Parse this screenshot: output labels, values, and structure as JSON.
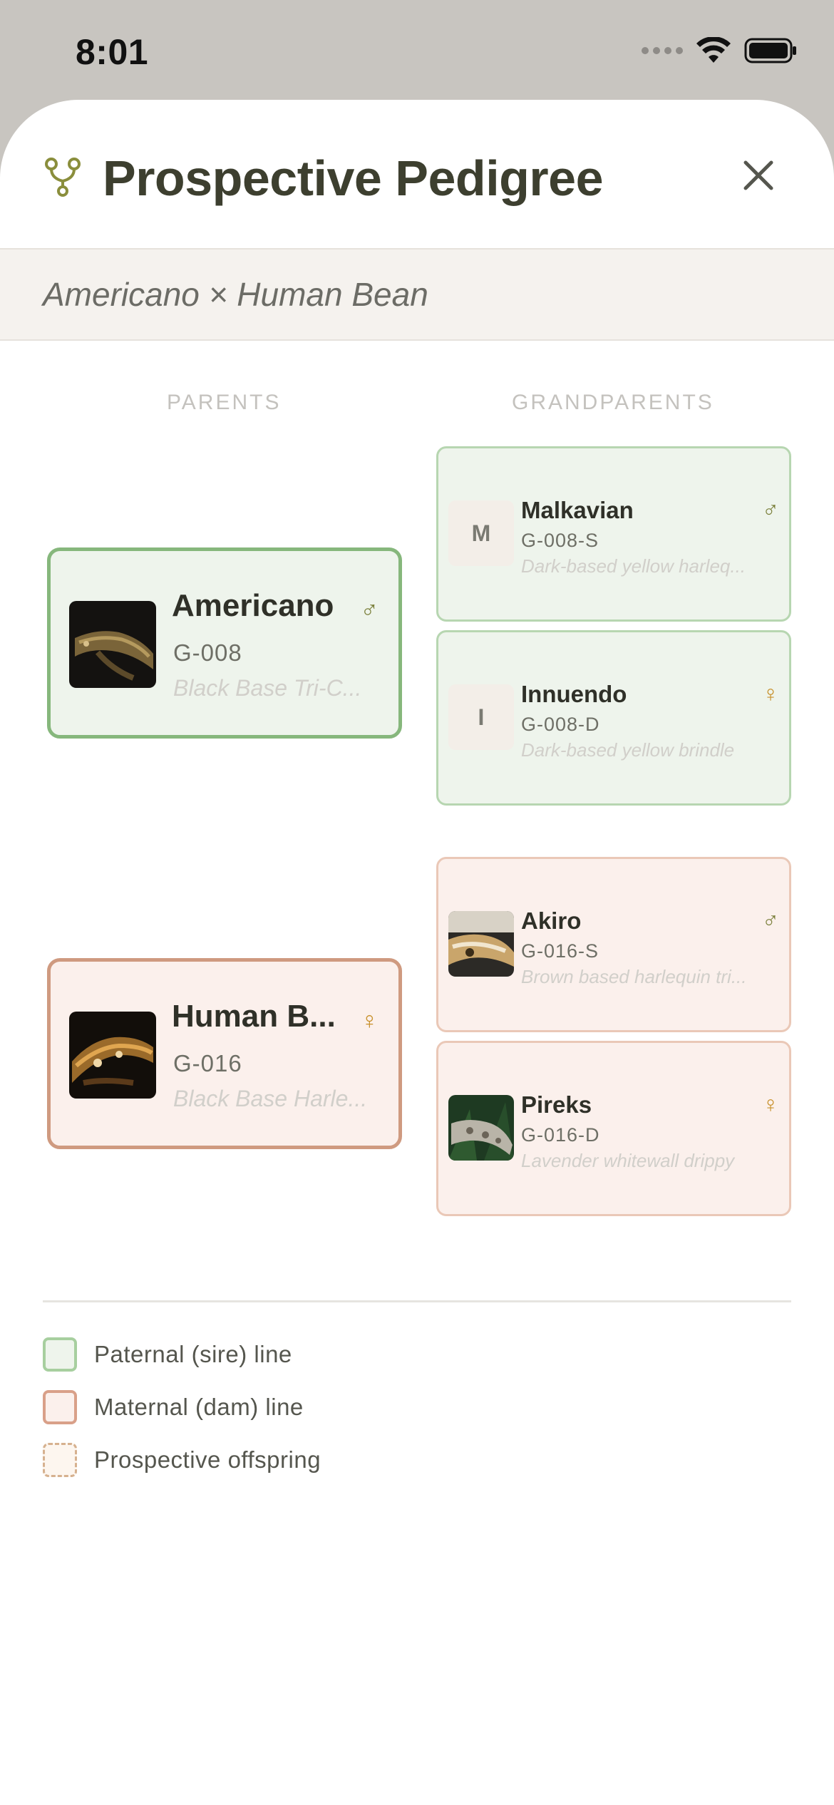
{
  "status_bar": {
    "time": "8:01"
  },
  "header": {
    "title": "Prospective Pedigree"
  },
  "pairing": {
    "text": "Americano × Human Bean"
  },
  "columns": {
    "parents": "PARENTS",
    "grandparents": "GRANDPARENTS"
  },
  "sire": {
    "name": "Americano",
    "id": "G-008",
    "desc": "Black Base Tri-C...",
    "sex": "♂",
    "sire": {
      "initial": "M",
      "name": "Malkavian",
      "id": "G-008-S",
      "desc": "Dark-based yellow harleq...",
      "sex": "♂"
    },
    "dam": {
      "initial": "I",
      "name": "Innuendo",
      "id": "G-008-D",
      "desc": "Dark-based yellow brindle",
      "sex": "♀"
    }
  },
  "dam": {
    "name": "Human B...",
    "id": "G-016",
    "desc": "Black Base Harle...",
    "sex": "♀",
    "sire": {
      "name": "Akiro",
      "id": "G-016-S",
      "desc": "Brown based harlequin tri...",
      "sex": "♂"
    },
    "dam": {
      "name": "Pireks",
      "id": "G-016-D",
      "desc": "Lavender whitewall drippy",
      "sex": "♀"
    }
  },
  "legend": {
    "sire_line": "Paternal (sire) line",
    "dam_line": "Maternal (dam) line",
    "offspring": "Prospective offspring"
  },
  "colors": {
    "sire_fill": "#eef4ec",
    "sire_border": "#86b77c",
    "dam_fill": "#fbf0ec",
    "dam_border": "#cf9a80",
    "title": "#3d3f2f"
  }
}
